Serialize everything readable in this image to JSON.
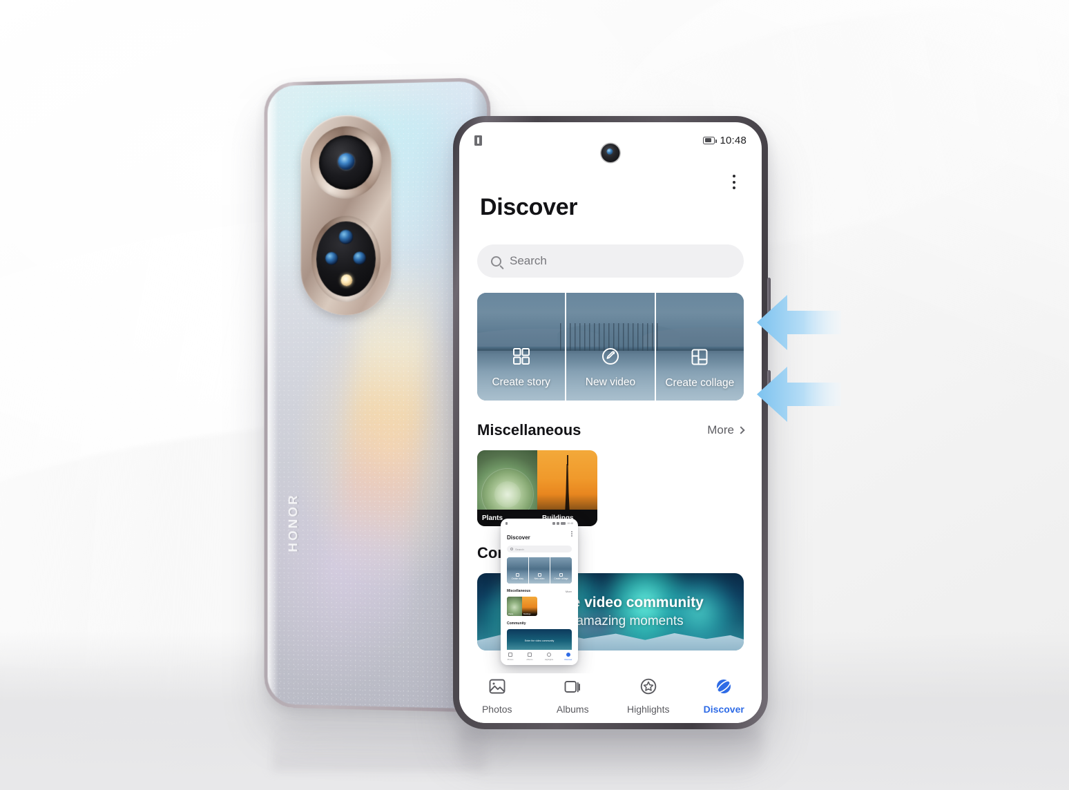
{
  "device": {
    "brand_logo": "HONOR",
    "rear_camera_name": "dual-ring-camera-module",
    "side_buttons": [
      "volume-button",
      "power-button"
    ]
  },
  "status_bar": {
    "left_icon": "document-icon",
    "battery_icon": "battery-icon",
    "time": "10:48"
  },
  "header": {
    "title": "Discover",
    "overflow_icon": "more-vertical-icon"
  },
  "search": {
    "icon": "search-icon",
    "placeholder": "Search"
  },
  "action_cards": [
    {
      "icon": "grid-squares-icon",
      "label": "Create story"
    },
    {
      "icon": "pen-circle-icon",
      "label": "New video"
    },
    {
      "icon": "collage-layout-icon",
      "label": "Create collage"
    }
  ],
  "miscellaneous": {
    "title": "Miscellaneous",
    "more_label": "More",
    "more_icon": "chevron-right-icon",
    "thumbnails": [
      {
        "name": "succulent-plant-thumbnail",
        "label": "Plants"
      },
      {
        "name": "tower-sunset-thumbnail",
        "label": "Buildings"
      }
    ]
  },
  "community": {
    "title": "Community",
    "banner_title": "Enter the video community",
    "banner_subtitle": "Share amazing moments"
  },
  "bottom_nav": [
    {
      "icon": "photos-icon",
      "label": "Photos",
      "active": false
    },
    {
      "icon": "albums-icon",
      "label": "Albums",
      "active": false
    },
    {
      "icon": "highlights-icon",
      "label": "Highlights",
      "active": false
    },
    {
      "icon": "discover-icon",
      "label": "Discover",
      "active": true
    }
  ],
  "mini_preview": {
    "title": "Discover",
    "search_placeholder": "Search",
    "cards": [
      {
        "label": "Create story"
      },
      {
        "label": "New video"
      },
      {
        "label": "Create collage"
      }
    ],
    "misc_title": "Miscellaneous",
    "more_label": "More",
    "thumb_labels": [
      "Plants",
      "Buildings"
    ],
    "community_title": "Community",
    "banner_text": "Enter the video community",
    "nav": [
      "Photos",
      "Albums",
      "Highlights",
      "Discover"
    ]
  },
  "annotations": {
    "arrow_top": "arrow-pointing-volume-button",
    "arrow_bottom": "arrow-pointing-power-button"
  },
  "colors": {
    "accent_blue": "#2e6be6",
    "arrow_blue": "#9fd0f2",
    "card_overlay": "#4a6c86",
    "text_primary": "#131316",
    "text_secondary": "#5d5d62"
  }
}
